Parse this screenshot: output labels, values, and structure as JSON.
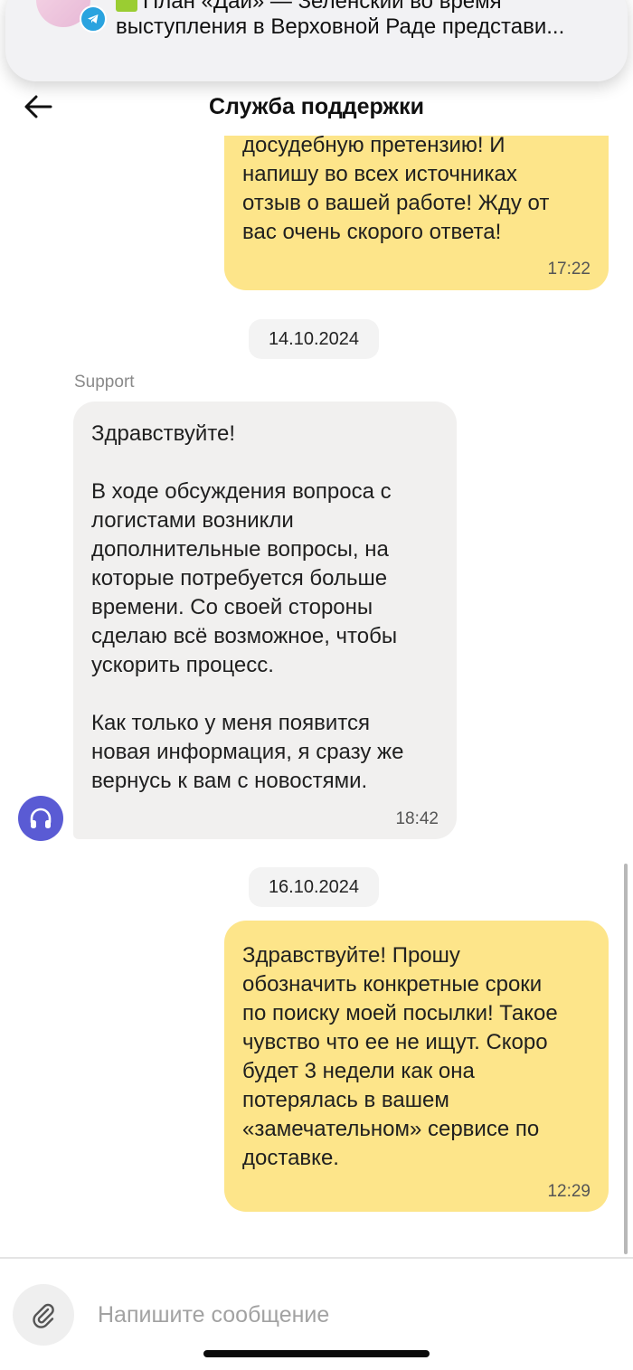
{
  "notification": {
    "line1": "План «Дай» — Зеленский во время",
    "line2": "выступления в Верховной Раде представи...",
    "app_icon": "telegram-icon"
  },
  "header": {
    "title": "Служба поддержки",
    "back_icon": "arrow-left-icon"
  },
  "messages": [
    {
      "direction": "outgoing",
      "text": "досудебную претензию! И\nнапишу во всех источниках\nотзыв о вашей работе! Жду от\nвас очень скорого ответа!",
      "time": "17:22"
    },
    {
      "date_separator": "14.10.2024"
    },
    {
      "direction": "incoming",
      "sender": "Support",
      "text": "Здравствуйте!\n\nВ ходе обсуждения вопроса с\nлогистами возникли\nдополнительные вопросы, на\nкоторые потребуется больше\nвремени. Со своей стороны\nсделаю всё возможное, чтобы\nускорить процесс.\n\nКак только у меня появится\nновая информация, я сразу же\nвернусь к вам с новостями.",
      "time": "18:42",
      "avatar_icon": "headphones-icon"
    },
    {
      "date_separator": "16.10.2024"
    },
    {
      "direction": "outgoing",
      "text": "Здравствуйте! Прошу\nобозначить конкретные сроки\nпо поиску моей посылки! Такое\nчувство что ее не ищут. Скоро\nбудет 3 недели как она\nпотерялась в вашем\n«замечательном» сервисе по\nдоставке.",
      "time": "12:29"
    }
  ],
  "input": {
    "placeholder": "Напишите сообщение",
    "value": "",
    "attach_icon": "paperclip-icon"
  },
  "colors": {
    "outgoing_bubble": "#fde58a",
    "incoming_bubble": "#f1f0ef",
    "support_avatar": "#5a5bd4",
    "telegram": "#2aa3df"
  }
}
